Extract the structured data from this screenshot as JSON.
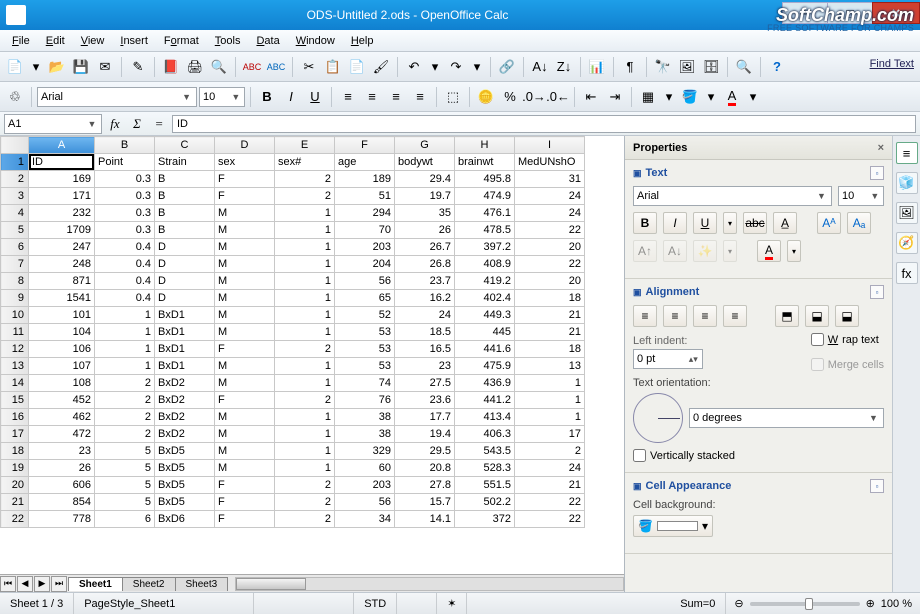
{
  "window": {
    "title": "ODS-Untitled 2.ods - OpenOffice Calc"
  },
  "sponsor": {
    "logo": "SoftChamp.com",
    "tag": "FREE SOFTWARE FOR CHAMPS"
  },
  "menu": [
    "File",
    "Edit",
    "View",
    "Insert",
    "Format",
    "Tools",
    "Data",
    "Window",
    "Help"
  ],
  "find_text": "Find Text",
  "format_bar": {
    "font": "Arial",
    "size": "10"
  },
  "cellref": {
    "ref": "A1",
    "formula": "ID"
  },
  "columns": [
    "A",
    "B",
    "C",
    "D",
    "E",
    "F",
    "G",
    "H",
    "I"
  ],
  "header_row": [
    "ID",
    "Point",
    "Strain",
    "sex",
    "sex#",
    "age",
    "bodywt",
    "brainwt",
    "MedUNshO"
  ],
  "rows": [
    [
      "169",
      "0.3",
      "B",
      "F",
      "2",
      "189",
      "29.4",
      "495.8",
      "31"
    ],
    [
      "171",
      "0.3",
      "B",
      "F",
      "2",
      "51",
      "19.7",
      "474.9",
      "24"
    ],
    [
      "232",
      "0.3",
      "B",
      "M",
      "1",
      "294",
      "35",
      "476.1",
      "24"
    ],
    [
      "1709",
      "0.3",
      "B",
      "M",
      "1",
      "70",
      "26",
      "478.5",
      "22"
    ],
    [
      "247",
      "0.4",
      "D",
      "M",
      "1",
      "203",
      "26.7",
      "397.2",
      "20"
    ],
    [
      "248",
      "0.4",
      "D",
      "M",
      "1",
      "204",
      "26.8",
      "408.9",
      "22"
    ],
    [
      "871",
      "0.4",
      "D",
      "M",
      "1",
      "56",
      "23.7",
      "419.2",
      "20"
    ],
    [
      "1541",
      "0.4",
      "D",
      "M",
      "1",
      "65",
      "16.2",
      "402.4",
      "18"
    ],
    [
      "101",
      "1",
      "BxD1",
      "M",
      "1",
      "52",
      "24",
      "449.3",
      "21"
    ],
    [
      "104",
      "1",
      "BxD1",
      "M",
      "1",
      "53",
      "18.5",
      "445",
      "21"
    ],
    [
      "106",
      "1",
      "BxD1",
      "F",
      "2",
      "53",
      "16.5",
      "441.6",
      "18"
    ],
    [
      "107",
      "1",
      "BxD1",
      "M",
      "1",
      "53",
      "23",
      "475.9",
      "13"
    ],
    [
      "108",
      "2",
      "BxD2",
      "M",
      "1",
      "74",
      "27.5",
      "436.9",
      "1"
    ],
    [
      "452",
      "2",
      "BxD2",
      "F",
      "2",
      "76",
      "23.6",
      "441.2",
      "1"
    ],
    [
      "462",
      "2",
      "BxD2",
      "M",
      "1",
      "38",
      "17.7",
      "413.4",
      "1"
    ],
    [
      "472",
      "2",
      "BxD2",
      "M",
      "1",
      "38",
      "19.4",
      "406.3",
      "17"
    ],
    [
      "23",
      "5",
      "BxD5",
      "M",
      "1",
      "329",
      "29.5",
      "543.5",
      "2"
    ],
    [
      "26",
      "5",
      "BxD5",
      "M",
      "1",
      "60",
      "20.8",
      "528.3",
      "24"
    ],
    [
      "606",
      "5",
      "BxD5",
      "F",
      "2",
      "203",
      "27.8",
      "551.5",
      "21"
    ],
    [
      "854",
      "5",
      "BxD5",
      "F",
      "2",
      "56",
      "15.7",
      "502.2",
      "22"
    ],
    [
      "778",
      "6",
      "BxD6",
      "F",
      "2",
      "34",
      "14.1",
      "372",
      "22"
    ]
  ],
  "sheet_tabs": [
    "Sheet1",
    "Sheet2",
    "Sheet3"
  ],
  "properties": {
    "title": "Properties",
    "text_section": "Text",
    "font": "Arial",
    "size": "10",
    "align_section": "Alignment",
    "left_indent_label": "Left indent:",
    "left_indent": "0 pt",
    "wrap": "Wrap text",
    "merge": "Merge cells",
    "orient_label": "Text orientation:",
    "degrees": "0 degrees",
    "stacked": "Vertically stacked",
    "cellapp_section": "Cell Appearance",
    "cellbg_label": "Cell background:"
  },
  "status": {
    "sheet": "Sheet 1 / 3",
    "pagestyle": "PageStyle_Sheet1",
    "std": "STD",
    "sum": "Sum=0",
    "zoom": "100 %"
  }
}
